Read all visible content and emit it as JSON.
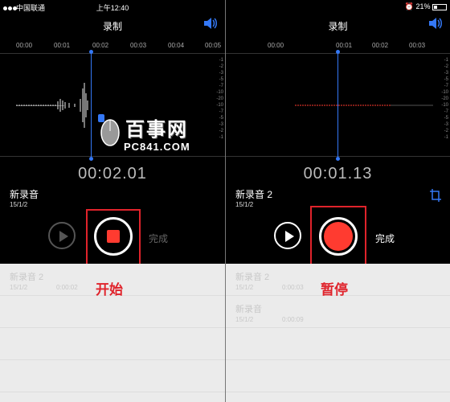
{
  "status": {
    "carrier": "中国联通",
    "time": "上午12:40",
    "battery": "21%"
  },
  "title": "录制",
  "ruler_labels": [
    "00:00",
    "00:01",
    "00:02",
    "00:03",
    "00:04",
    "00:05"
  ],
  "ruler_labels_right": [
    "00:00",
    "00:01",
    "00:02",
    "00:03"
  ],
  "db_scale": [
    "-1",
    "-2",
    "-3",
    "-5",
    "-7",
    "-10",
    "-20",
    "-10",
    "-7",
    "-5",
    "-3",
    "-2",
    "-1"
  ],
  "left": {
    "elapsed": "00:02.01",
    "recording_name": "新录音",
    "recording_date": "15/1/2",
    "done_label": "完成",
    "caption": "开始",
    "list": [
      {
        "name": "新录音 2",
        "date": "15/1/2",
        "duration": "0:00:02"
      }
    ]
  },
  "right": {
    "elapsed": "00:01.13",
    "recording_name": "新录音 2",
    "recording_date": "15/1/2",
    "done_label": "完成",
    "caption": "暂停",
    "list": [
      {
        "name": "新录音 2",
        "date": "15/1/2",
        "duration": "0:00:03"
      },
      {
        "name": "新录音",
        "date": "15/1/2",
        "duration": "0:00:09"
      }
    ]
  },
  "watermark": {
    "brand": "百事网",
    "domain": "PC841.COM"
  },
  "colors": {
    "accent_blue": "#3478f6",
    "record_red": "#ff3b30",
    "highlight_red": "#e0232b"
  }
}
